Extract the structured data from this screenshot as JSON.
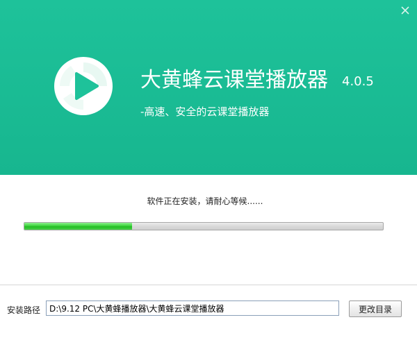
{
  "window": {
    "close_icon": "close-icon"
  },
  "header": {
    "logo_icon": "play-logo-icon",
    "title": "大黄蜂云课堂播放器",
    "version": "4.0.5",
    "subtitle": "-高速、安全的云课堂播放器",
    "background_color": "#1bbd95"
  },
  "progress": {
    "status_text": "软件正在安装，请耐心等候......",
    "percent": 30,
    "fill_color": "#33cc33"
  },
  "install": {
    "path_label": "安装路径",
    "path_value": "D:\\9.12 PC\\大黄蜂播放器\\大黄蜂云课堂播放器",
    "change_button_label": "更改目录"
  }
}
